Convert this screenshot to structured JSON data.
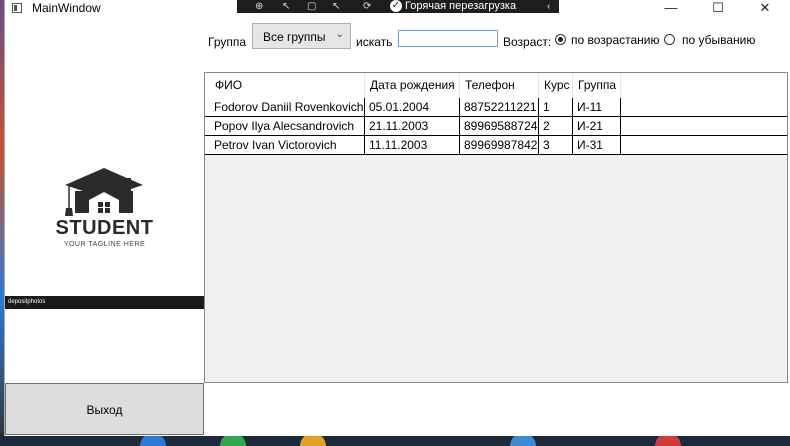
{
  "window": {
    "title": "MainWindow",
    "minimize": "—",
    "maximize": "☐",
    "close": "✕"
  },
  "devbar": {
    "hot_reload": "Горячая перезагрузка",
    "check": "✓",
    "collapse": "‹"
  },
  "toolbar": {
    "group_label": "Группа",
    "group_value": "Все группы",
    "search_label": "искать",
    "search_value": "",
    "age_label": "Возраст:",
    "asc_label": "по возрастанию",
    "desc_label": "по убыванию",
    "asc_selected": true
  },
  "logo": {
    "title": "STUDENT",
    "tagline": "YOUR TAGLINE HERE",
    "stock": "depositphotos"
  },
  "table": {
    "headers": [
      "ФИО",
      "Дата рождения",
      "Телефон",
      "Курс",
      "Группа"
    ],
    "rows": [
      [
        "Fodorov Daniil Rovenkovich",
        "05.01.2004",
        "88752211221",
        "1",
        "И-11"
      ],
      [
        "Popov Ilya Alecsandrovich",
        "21.11.2003",
        "89969588724",
        "2",
        "И-21"
      ],
      [
        "Petrov Ivan Victorovich",
        "11.11.2003",
        "89969987842",
        "3",
        "И-31"
      ]
    ]
  },
  "exit_label": "Выход",
  "colors": {
    "accent": "#0078d7",
    "grid_bg": "#f0f0f0",
    "button_bg": "#dddddd"
  }
}
